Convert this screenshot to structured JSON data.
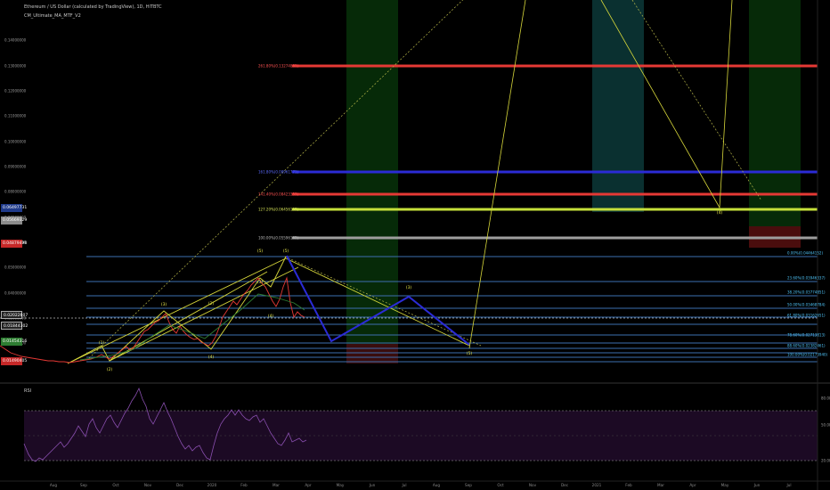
{
  "header": {
    "title": "Ethereum / US Dollar (calculated by TradingView), 1D, HITBTC",
    "indicator": "CM_Ultimate_MA_MTF_V2"
  },
  "rsi_label": "RSI",
  "price_axis": [
    "0.14000000",
    "0.13000000",
    "0.12000000",
    "0.11000000",
    "0.10000000",
    "0.09000000",
    "0.08000000",
    "0.07000000",
    "0.06000000",
    "0.05000000",
    "0.04000000",
    "0.03000000",
    "0.02000000"
  ],
  "price_tags": [
    {
      "text": "0.06497731",
      "bg": "#1f3a8a"
    },
    {
      "text": "0.05669329",
      "bg": "#8c8c8c"
    },
    {
      "text": "0.04879498",
      "bg": "#c62828"
    },
    {
      "text": "0.02022607",
      "bg": "#222222"
    },
    {
      "text": "0.01844302",
      "bg": "#222222"
    },
    {
      "text": "0.01454316",
      "bg": "#2e7d32"
    },
    {
      "text": "0.01490405",
      "bg": "#c62828"
    }
  ],
  "fib_labels": [
    {
      "text": "261.80%(0.13274881)",
      "color": "#ff5252"
    },
    {
      "text": "161.80%(0.08961771)",
      "color": "#5c6bff"
    },
    {
      "text": "141.40%(0.08423353)",
      "color": "#ff5252"
    },
    {
      "text": "127.20%(0.06456195)",
      "color": "#d4e157"
    },
    {
      "text": "100.00%(0.05596162)",
      "color": "#bdbdbd"
    },
    {
      "text": "0.00%(0.04464152)",
      "color": "#4fc3f7"
    },
    {
      "text": "23.60%(0.03946337)",
      "color": "#4fc3f7"
    },
    {
      "text": "38.20%(0.03774851)",
      "color": "#4fc3f7"
    },
    {
      "text": "50.00%(0.03468784)",
      "color": "#4fc3f7"
    },
    {
      "text": "61.80%(0.03162651)",
      "color": "#4fc3f7"
    },
    {
      "text": "78.60%(0.02713813)",
      "color": "#4fc3f7"
    },
    {
      "text": "88.60%(0.02382461)",
      "color": "#4fc3f7"
    },
    {
      "text": "100.00%(0.02173940)",
      "color": "#4fc3f7"
    }
  ],
  "wave_labels": [
    "(1)",
    "(2)",
    "(3)",
    "(4)",
    "(5)",
    "(2)",
    "(3)",
    "(4)",
    "(5)",
    "(4)",
    "(3)",
    "(5)"
  ],
  "time_axis": [
    "Aug",
    "Sep",
    "Oct",
    "Nov",
    "Dec",
    "2020",
    "Feb",
    "Mar",
    "Apr",
    "May",
    "Jun",
    "Jul",
    "Aug",
    "Sep",
    "Oct",
    "Nov",
    "Dec",
    "2021",
    "Feb",
    "Mar",
    "Apr",
    "May",
    "Jun",
    "Jul"
  ],
  "rsi_axis": [
    "80.00",
    "50.00",
    "20.00"
  ],
  "colors": {
    "red": "#e53935",
    "blue": "#2b2bd6",
    "yellow_green": "#c6e03a",
    "gray": "#9e9e9e",
    "fib_blue": "#3d6fb0",
    "wave_yellow": "#d6d63a",
    "rsi_fill": "#1c0a24"
  }
}
